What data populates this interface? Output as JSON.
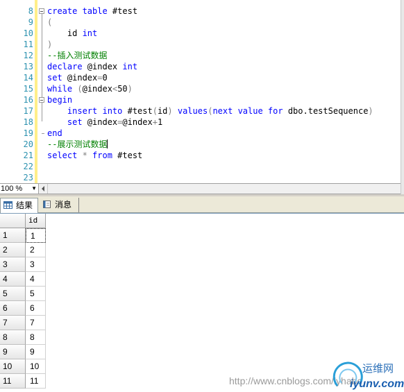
{
  "editor": {
    "line_numbers": [
      "8",
      "9",
      "10",
      "11",
      "12",
      "13",
      "14",
      "15",
      "16",
      "17",
      "18",
      "19",
      "20",
      "21",
      "22",
      "23"
    ],
    "lines": [
      [
        {
          "t": "create table ",
          "c": "kw"
        },
        {
          "t": "#test",
          "c": ""
        }
      ],
      [
        {
          "t": "(",
          "c": "gray"
        }
      ],
      [
        {
          "t": "    id ",
          "c": ""
        },
        {
          "t": "int",
          "c": "kw"
        }
      ],
      [
        {
          "t": ")",
          "c": "gray"
        }
      ],
      [
        {
          "t": "--插入测试数据",
          "c": "cm"
        }
      ],
      [
        {
          "t": "declare ",
          "c": "kw"
        },
        {
          "t": "@index ",
          "c": ""
        },
        {
          "t": "int",
          "c": "kw"
        }
      ],
      [
        {
          "t": "set ",
          "c": "kw"
        },
        {
          "t": "@index",
          "c": ""
        },
        {
          "t": "=",
          "c": "gray"
        },
        {
          "t": "0",
          "c": ""
        }
      ],
      [
        {
          "t": "while ",
          "c": "kw"
        },
        {
          "t": "(",
          "c": "gray"
        },
        {
          "t": "@index",
          "c": ""
        },
        {
          "t": "<",
          "c": "gray"
        },
        {
          "t": "50",
          "c": ""
        },
        {
          "t": ")",
          "c": "gray"
        }
      ],
      [
        {
          "t": "begin",
          "c": "kw"
        }
      ],
      [
        {
          "t": "    insert into ",
          "c": "kw"
        },
        {
          "t": "#test",
          "c": ""
        },
        {
          "t": "(",
          "c": "gray"
        },
        {
          "t": "id",
          "c": ""
        },
        {
          "t": ") ",
          "c": "gray"
        },
        {
          "t": "values",
          "c": "kw"
        },
        {
          "t": "(",
          "c": "gray"
        },
        {
          "t": "next value for ",
          "c": "kw"
        },
        {
          "t": "dbo.testSequence",
          "c": ""
        },
        {
          "t": ")",
          "c": "gray"
        }
      ],
      [
        {
          "t": "    set ",
          "c": "kw"
        },
        {
          "t": "@index",
          "c": ""
        },
        {
          "t": "=",
          "c": "gray"
        },
        {
          "t": "@index",
          "c": ""
        },
        {
          "t": "+",
          "c": "gray"
        },
        {
          "t": "1",
          "c": ""
        }
      ],
      [
        {
          "t": "end",
          "c": "kw"
        }
      ],
      [
        {
          "t": "--展示测试数据",
          "c": "cm"
        },
        {
          "t": "|caret|",
          "c": "caret"
        }
      ],
      [
        {
          "t": "select ",
          "c": "kw"
        },
        {
          "t": "* ",
          "c": "gray"
        },
        {
          "t": "from ",
          "c": "kw"
        },
        {
          "t": "#test",
          "c": ""
        }
      ],
      [],
      []
    ]
  },
  "zoom": {
    "value": "100 %"
  },
  "tabs": [
    {
      "label": "结果",
      "icon": "grid-icon",
      "active": true
    },
    {
      "label": "消息",
      "icon": "message-icon",
      "active": false
    }
  ],
  "results": {
    "columns": [
      "id"
    ],
    "row_numbers": [
      "1",
      "2",
      "3",
      "4",
      "5",
      "6",
      "7",
      "8",
      "9",
      "10",
      "11"
    ],
    "rows": [
      [
        "1"
      ],
      [
        "2"
      ],
      [
        "3"
      ],
      [
        "4"
      ],
      [
        "5"
      ],
      [
        "6"
      ],
      [
        "7"
      ],
      [
        "8"
      ],
      [
        "9"
      ],
      [
        "10"
      ],
      [
        "11"
      ]
    ]
  },
  "watermark": {
    "url_text": "http://www.cnblogs.com/lyhabc",
    "logo_cn": "运维网",
    "logo_en": "iyunv.com"
  },
  "colors": {
    "keyword": "#0000ff",
    "comment": "#008000",
    "line_number": "#2b91af",
    "change_bar": "#ffef8a"
  }
}
